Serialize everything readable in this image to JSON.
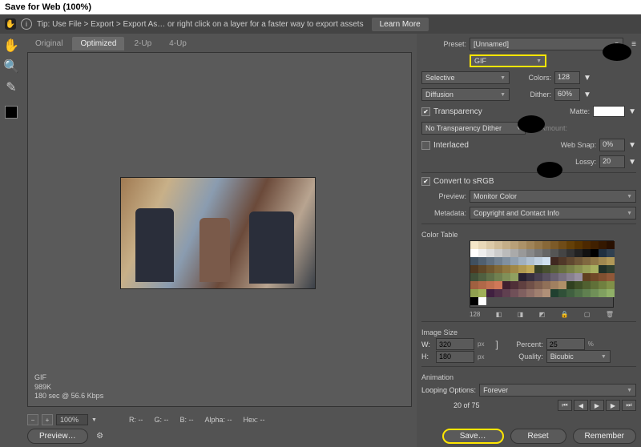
{
  "title": "Save for Web (100%)",
  "tip": "Tip: Use File > Export > Export As…  or right click on a layer for a faster way to export assets",
  "learnMore": "Learn More",
  "tabs": {
    "original": "Original",
    "optimized": "Optimized",
    "twoup": "2-Up",
    "fourup": "4-Up"
  },
  "previewInfo": {
    "format": "GIF",
    "size": "989K",
    "time": "180 sec @ 56.6 Kbps"
  },
  "bottom": {
    "zoom": "100%",
    "r": "R: --",
    "g": "G: --",
    "b": "B: --",
    "alpha": "Alpha: --",
    "hex": "Hex: --",
    "previewBtn": "Preview…"
  },
  "right": {
    "presetLabel": "Preset:",
    "presetValue": "[Unnamed]",
    "format": "GIF",
    "reduction": "Selective",
    "colorsLabel": "Colors:",
    "colors": "128",
    "dither": "Diffusion",
    "ditherLabel": "Dither:",
    "ditherPct": "60%",
    "transparency": "Transparency",
    "matteLabel": "Matte:",
    "transDither": "No Transparency Dither",
    "amountLabel": "Amount:",
    "interlaced": "Interlaced",
    "webSnapLabel": "Web Snap:",
    "webSnap": "0%",
    "lossyLabel": "Lossy:",
    "lossy": "20",
    "convertSRGB": "Convert to sRGB",
    "previewLabel": "Preview:",
    "previewValue": "Monitor Color",
    "metadataLabel": "Metadata:",
    "metadataValue": "Copyright and Contact Info",
    "colorTableLabel": "Color Table",
    "colorCount": "128",
    "imageSizeLabel": "Image Size",
    "w": "W:",
    "wVal": "320",
    "h": "H:",
    "hVal": "180",
    "px": "px",
    "percentLabel": "Percent:",
    "percent": "25",
    "pctUnit": "%",
    "qualityLabel": "Quality:",
    "quality": "Bicubic",
    "animLabel": "Animation",
    "loopLabel": "Looping Options:",
    "loopValue": "Forever",
    "frames": "20 of 75"
  },
  "footer": {
    "save": "Save…",
    "reset": "Reset",
    "remember": "Remember"
  },
  "palette": [
    "#f4e6c8",
    "#e8d8b8",
    "#dccaa8",
    "#d0bc98",
    "#c4ae88",
    "#b8a078",
    "#ac9268",
    "#a08458",
    "#947648",
    "#886838",
    "#7c5a28",
    "#704c18",
    "#644008",
    "#583400",
    "#4c2800",
    "#402000",
    "#341800",
    "#281000",
    "#fff",
    "#eee",
    "#ddd",
    "#ccc",
    "#bbb",
    "#aaa",
    "#999",
    "#888",
    "#777",
    "#666",
    "#555",
    "#444",
    "#333",
    "#222",
    "#111",
    "#000",
    "#203040",
    "#304050",
    "#405060",
    "#506070",
    "#607080",
    "#708090",
    "#8090a0",
    "#90a0b0",
    "#a0b0c0",
    "#b0c0d0",
    "#c0d0e0",
    "#d0e0f0",
    "#402820",
    "#503828",
    "#604830",
    "#705838",
    "#806840",
    "#907848",
    "#a08850",
    "#b09858",
    "#503820",
    "#604828",
    "#705830",
    "#806838",
    "#907840",
    "#a08848",
    "#b09850",
    "#c0a858",
    "#384028",
    "#485030",
    "#586038",
    "#687040",
    "#788048",
    "#889050",
    "#98a058",
    "#a8b060",
    "#203028",
    "#304030",
    "#405038",
    "#506040",
    "#607048",
    "#708050",
    "#809058",
    "#90a060",
    "#282030",
    "#383040",
    "#484050",
    "#585060",
    "#686070",
    "#787080",
    "#888090",
    "#9890a0",
    "#604020",
    "#704828",
    "#805030",
    "#905838",
    "#a06040",
    "#b06848",
    "#c07050",
    "#d07858",
    "#402030",
    "#503038",
    "#604040",
    "#705048",
    "#806050",
    "#907058",
    "#a08060",
    "#b09068",
    "#304020",
    "#405028",
    "#506030",
    "#607038",
    "#708040",
    "#809048",
    "#90a050",
    "#a0b058",
    "#402040",
    "#503048",
    "#604050",
    "#705058",
    "#806060",
    "#907068",
    "#a08070",
    "#b09078",
    "#204030",
    "#305038",
    "#406040",
    "#507048",
    "#608050",
    "#709058",
    "#80a060",
    "#90b068",
    "#000",
    "#fff"
  ]
}
